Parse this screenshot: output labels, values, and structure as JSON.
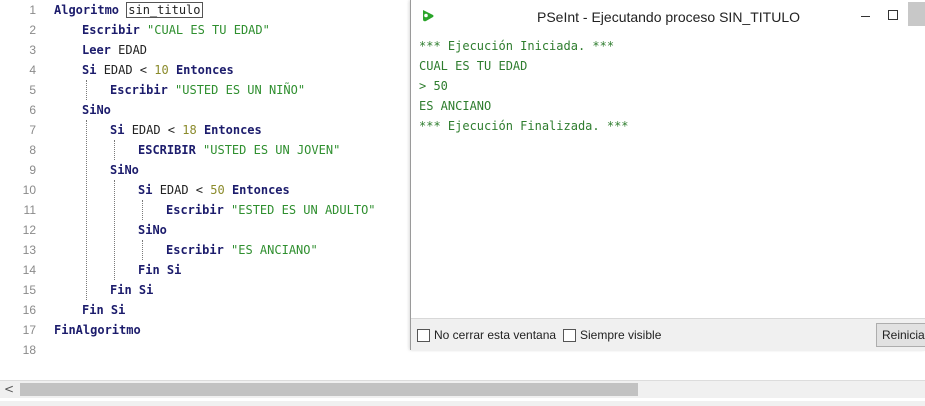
{
  "editor": {
    "line_numbers": [
      "1",
      "2",
      "3",
      "4",
      "5",
      "6",
      "7",
      "8",
      "9",
      "10",
      "11",
      "12",
      "13",
      "14",
      "15",
      "16",
      "17",
      "18"
    ],
    "lines": [
      [
        {
          "t": "Algoritmo ",
          "c": "kw"
        },
        {
          "t": "sin_titulo",
          "c": "cur"
        }
      ],
      [
        {
          "t": "Escribir ",
          "c": "kw"
        },
        {
          "t": "\"CUAL ES TU EDAD\"",
          "c": "str"
        }
      ],
      [
        {
          "t": "Leer ",
          "c": "kw"
        },
        {
          "t": "EDAD",
          "c": "id"
        }
      ],
      [
        {
          "t": "Si ",
          "c": "kw"
        },
        {
          "t": "EDAD < ",
          "c": "op"
        },
        {
          "t": "10",
          "c": "num"
        },
        {
          "t": " Entonces",
          "c": "kw"
        }
      ],
      [
        {
          "t": "Escribir ",
          "c": "kw"
        },
        {
          "t": "\"USTED ES UN NIÑO\"",
          "c": "str"
        }
      ],
      [
        {
          "t": "SiNo",
          "c": "kw"
        }
      ],
      [
        {
          "t": "Si ",
          "c": "kw"
        },
        {
          "t": "EDAD < ",
          "c": "op"
        },
        {
          "t": "18",
          "c": "num"
        },
        {
          "t": " Entonces",
          "c": "kw"
        }
      ],
      [
        {
          "t": "ESCRIBIR ",
          "c": "kw"
        },
        {
          "t": "\"USTED ES UN JOVEN\"",
          "c": "str"
        }
      ],
      [
        {
          "t": "SiNo",
          "c": "kw"
        }
      ],
      [
        {
          "t": "Si ",
          "c": "kw"
        },
        {
          "t": "EDAD < ",
          "c": "op"
        },
        {
          "t": "50",
          "c": "num"
        },
        {
          "t": " Entonces",
          "c": "kw"
        }
      ],
      [
        {
          "t": "Escribir ",
          "c": "kw"
        },
        {
          "t": "\"ESTED ES UN ADULTO\"",
          "c": "str"
        }
      ],
      [
        {
          "t": "SiNo",
          "c": "kw"
        }
      ],
      [
        {
          "t": "Escribir ",
          "c": "kw"
        },
        {
          "t": "\"ES ANCIANO\"",
          "c": "str"
        }
      ],
      [
        {
          "t": "Fin Si",
          "c": "kw"
        }
      ],
      [
        {
          "t": "Fin Si",
          "c": "kw"
        }
      ],
      [
        {
          "t": "Fin Si",
          "c": "kw"
        }
      ],
      [
        {
          "t": "FinAlgoritmo",
          "c": "kw"
        }
      ],
      []
    ],
    "indents": [
      0,
      1,
      1,
      1,
      2,
      1,
      2,
      3,
      2,
      3,
      4,
      3,
      4,
      3,
      2,
      1,
      0,
      0
    ]
  },
  "console": {
    "title": "PSeInt - Ejecutando proceso SIN_TITULO",
    "output": [
      "*** Ejecución Iniciada. ***",
      "CUAL ES TU EDAD",
      "> 50",
      "ES ANCIANO",
      "*** Ejecución Finalizada. ***"
    ],
    "no_close_label": "No cerrar esta ventana",
    "always_visible_label": "Siempre visible",
    "restart_label": "Reiniciar"
  },
  "scrollbar": {
    "left_arrow": "<"
  },
  "colors": {
    "keyword": "#1c1c6c",
    "string": "#2f8f2f",
    "number": "#8a8a2a",
    "output": "#2e7d2e",
    "icon": "#2aa52a"
  },
  "icons": {
    "app": "pseint-run-icon",
    "minimize": "minimize-icon",
    "maximize": "maximize-icon"
  }
}
